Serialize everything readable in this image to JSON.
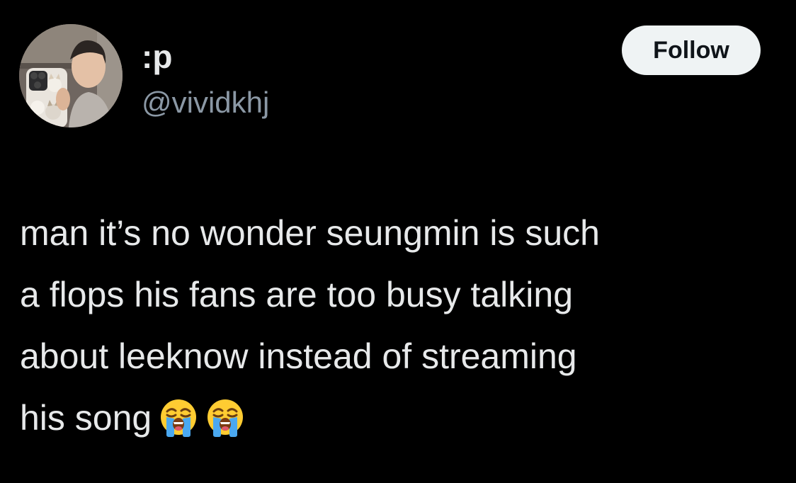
{
  "tweet": {
    "display_name": ":p",
    "handle": "@vividkhj",
    "follow_label": "Follow",
    "text_lines": [
      "man it’s no wonder seungmin is such",
      "a flops his fans are too busy talking",
      "about leeknow instead of streaming",
      "his song"
    ],
    "emoji": [
      "loudly-crying-face-icon",
      "loudly-crying-face-icon"
    ]
  },
  "colors": {
    "background": "#000000",
    "primary_text": "#e7e9ea",
    "secondary_text": "#8b98a5",
    "follow_bg": "#eff3f4",
    "follow_text": "#0f1419"
  }
}
